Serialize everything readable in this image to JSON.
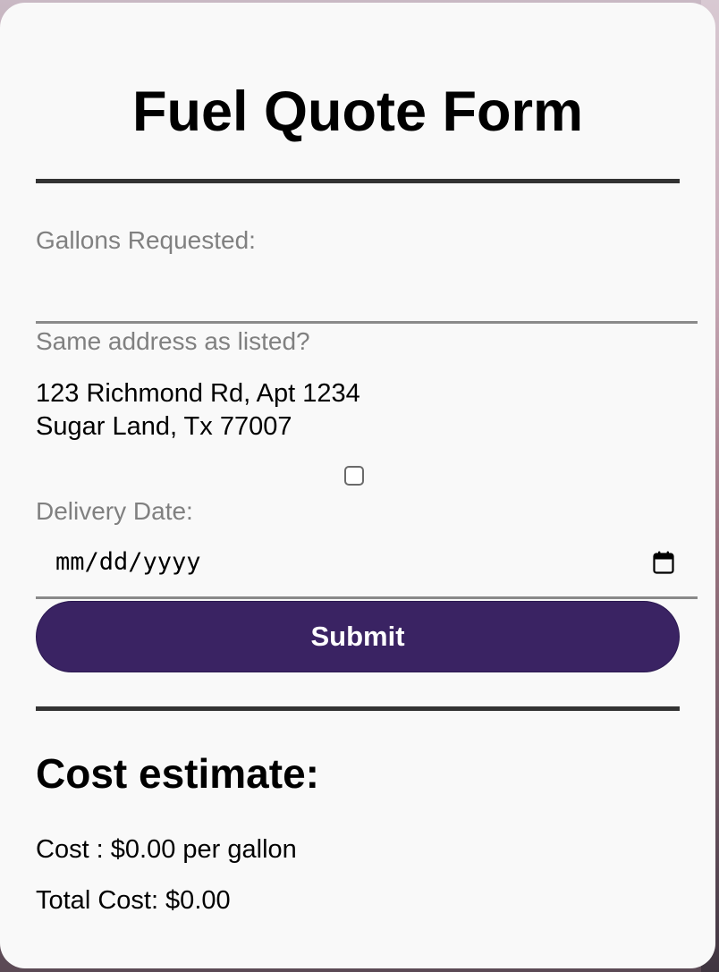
{
  "form": {
    "title": "Fuel Quote Form",
    "gallons_label": "Gallons Requested:",
    "gallons_value": "",
    "same_address_label": "Same address as listed?",
    "address_line1": "123 Richmond Rd, Apt 1234",
    "address_line2": "Sugar Land, Tx 77007",
    "same_address_checked": false,
    "delivery_date_label": "Delivery Date:",
    "delivery_date_placeholder": "mm/dd/yyyy",
    "calendar_icon": "calendar-icon",
    "submit_label": "Submit"
  },
  "estimate": {
    "heading": "Cost estimate:",
    "cost_line": "Cost : $0.00 per gallon",
    "total_line": "Total Cost: $0.00"
  },
  "colors": {
    "submit_bg": "#3a2363",
    "rule": "#333333",
    "label": "#808080",
    "card_bg": "#f9f9f9"
  }
}
